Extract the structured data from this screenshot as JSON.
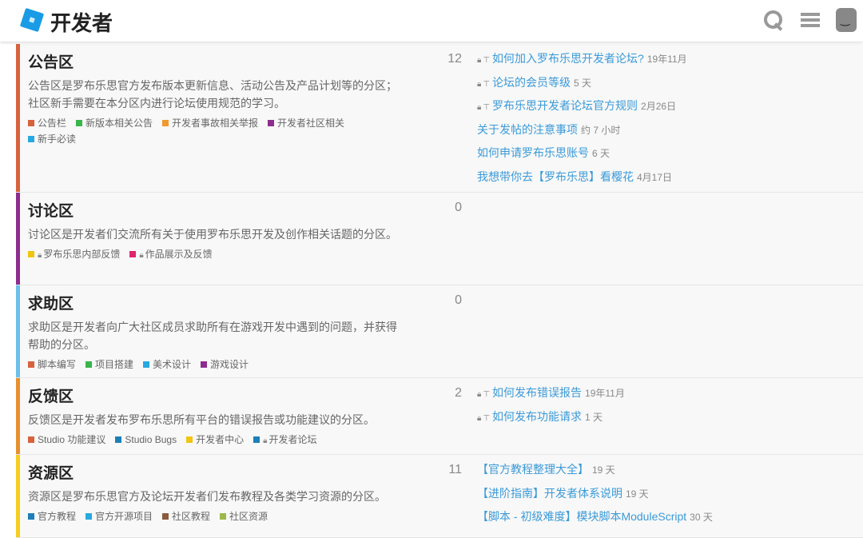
{
  "header": {
    "title": "开发者",
    "icons": [
      "roblox-logo",
      "search-icon",
      "menu-icon",
      "avatar"
    ]
  },
  "categories": [
    {
      "name": "公告区",
      "color": "#d8623e",
      "count": "12",
      "height": 186,
      "description": "公告区是罗布乐思官方发布版本更新信息、活动公告及产品计划等的分区；社区新手需要在本分区内进行论坛使用规范的学习。",
      "subcategories": [
        {
          "name": "公告栏",
          "color": "#d8623e"
        },
        {
          "name": "新版本相关公告",
          "color": "#3ab54a"
        },
        {
          "name": "开发者事故相关举报",
          "color": "#f1992e"
        },
        {
          "name": "开发者社区相关",
          "color": "#8c2d8e"
        },
        {
          "name": "新手必读",
          "color": "#27a9e1"
        }
      ],
      "topics": [
        {
          "title": "如何加入罗布乐思开发者论坛?",
          "age": "19年11月",
          "locked": true,
          "pinned": true
        },
        {
          "title": "论坛的会员等级",
          "age": "5 天",
          "locked": true,
          "pinned": true
        },
        {
          "title": "罗布乐思开发者论坛官方规则",
          "age": "2月26日",
          "locked": true,
          "pinned": true
        },
        {
          "title": "关于发帖的注意事项",
          "age": "约 7 小时"
        },
        {
          "title": "如何申请罗布乐思账号",
          "age": "6 天"
        },
        {
          "title": "我想带你去【罗布乐思】看樱花",
          "age": "4月17日"
        }
      ]
    },
    {
      "name": "讨论区",
      "color": "#8c2d8e",
      "count": "0",
      "height": 116,
      "description": "讨论区是开发者们交流所有关于使用罗布乐思开发及创作相关话题的分区。",
      "subcategories": [
        {
          "name": "罗布乐思内部反馈",
          "color": "#f1c40f",
          "locked": true
        },
        {
          "name": "作品展示及反馈",
          "color": "#e0256f",
          "locked": true
        }
      ],
      "topics": []
    },
    {
      "name": "求助区",
      "color": "#6cbfe8",
      "count": "0",
      "height": 116,
      "description": "求助区是开发者向广大社区成员求助所有在游戏开发中遇到的问题，并获得帮助的分区。",
      "subcategories": [
        {
          "name": "脚本编写",
          "color": "#d8623e"
        },
        {
          "name": "项目搭建",
          "color": "#3ab54a"
        },
        {
          "name": "美术设计",
          "color": "#27a9e1"
        },
        {
          "name": "游戏设计",
          "color": "#8c2d8e"
        }
      ],
      "topics": []
    },
    {
      "name": "反馈区",
      "color": "#e7902e",
      "count": "2",
      "height": 96,
      "description": "反馈区是开发者发布罗布乐思所有平台的错误报告或功能建议的分区。",
      "subcategories": [
        {
          "name": "Studio 功能建议",
          "color": "#d8623e"
        },
        {
          "name": "Studio Bugs",
          "color": "#1e7fb8"
        },
        {
          "name": "开发者中心",
          "color": "#f1c40f"
        },
        {
          "name": "开发者论坛",
          "color": "#1e7fb8",
          "locked": true
        }
      ],
      "topics": [
        {
          "title": "如何发布错误报告",
          "age": "19年11月",
          "locked": true,
          "pinned": true
        },
        {
          "title": "如何发布功能请求",
          "age": "1 天",
          "locked": true,
          "pinned": true
        }
      ]
    },
    {
      "name": "资源区",
      "color": "#f5cd1f",
      "count": "11",
      "height": 104,
      "description": "资源区是罗布乐思官方及论坛开发者们发布教程及各类学习资源的分区。",
      "subcategories": [
        {
          "name": "官方教程",
          "color": "#1e7fb8"
        },
        {
          "name": "官方开源项目",
          "color": "#27a9e1"
        },
        {
          "name": "社区教程",
          "color": "#8a5a3b"
        },
        {
          "name": "社区资源",
          "color": "#9cb84a"
        }
      ],
      "topics": [
        {
          "title": "【官方教程整理大全】",
          "age": "19 天"
        },
        {
          "title": "【进阶指南】开发者体系说明",
          "age": "19 天"
        },
        {
          "title": "【脚本 - 初级难度】模块脚本ModuleScript",
          "age": "30 天"
        }
      ]
    }
  ]
}
